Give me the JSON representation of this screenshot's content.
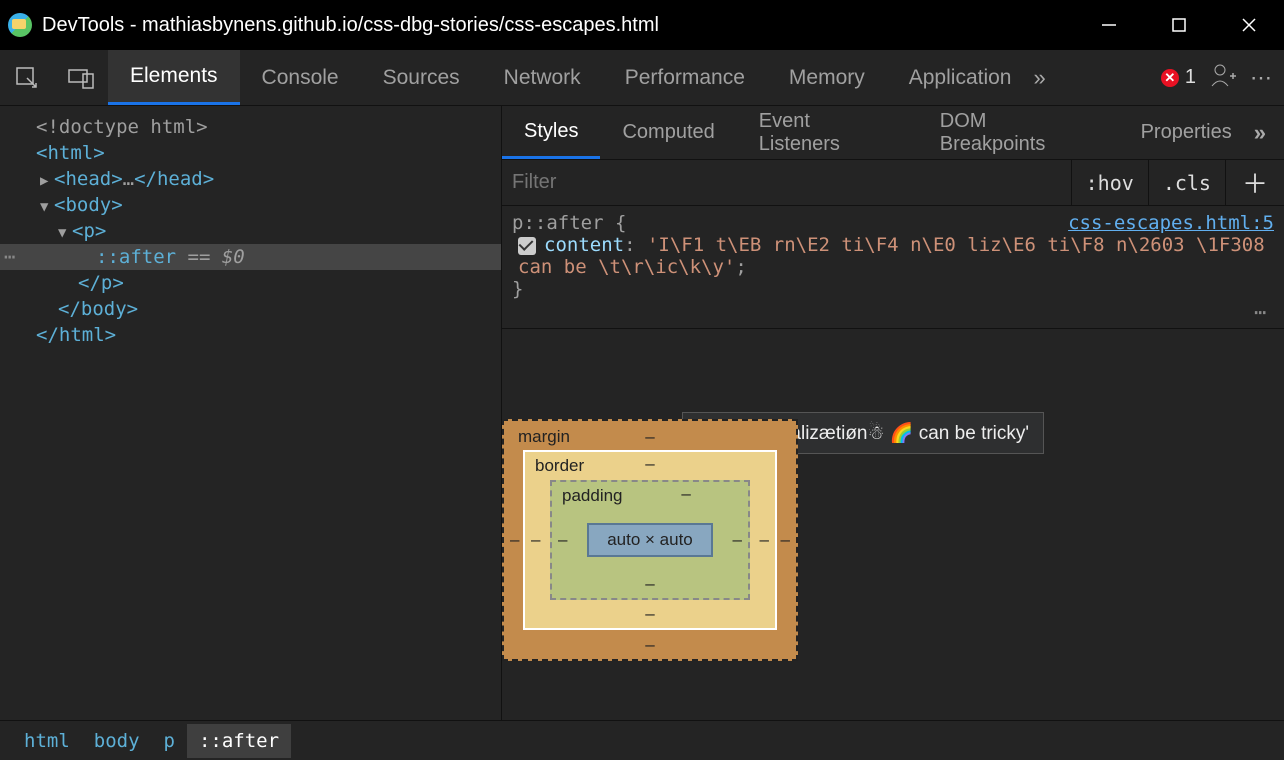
{
  "window": {
    "title": "DevTools - mathiasbynens.github.io/css-dbg-stories/css-escapes.html"
  },
  "toolbar": {
    "error_count": "1",
    "tabs": [
      "Elements",
      "Console",
      "Sources",
      "Network",
      "Performance",
      "Memory",
      "Application"
    ],
    "active_tab": 0
  },
  "dom": {
    "doctype": "<!doctype html>",
    "html_open": "<html>",
    "head": "<head>",
    "head_ellipsis": "…",
    "head_close": "</head>",
    "body_open": "<body>",
    "p_open": "<p>",
    "after": "::after",
    "eq0": "== $0",
    "p_close": "</p>",
    "body_close": "</body>",
    "html_close": "</html>"
  },
  "subTabs": [
    "Styles",
    "Computed",
    "Event Listeners",
    "DOM Breakpoints",
    "Properties"
  ],
  "filter": {
    "placeholder": "Filter",
    "hov": ":hov",
    "cls": ".cls"
  },
  "rule": {
    "selector": "p::after {",
    "source": "css-escapes.html:5",
    "prop": "content",
    "value": "'I\\F1 t\\EB rn\\E2 ti\\F4 n\\E0 liz\\E6 ti\\F8 n\\2603 \\1F308 can be \\t\\r\\ic\\k\\y'",
    "close": "}"
  },
  "tooltip": "'Iñtërnâtiônàlizætiøn☃ 🌈 can be tricky'",
  "boxModel": {
    "margin": "margin",
    "border": "border",
    "padding": "padding",
    "content": "auto × auto",
    "dash": "‒"
  },
  "breadcrumb": [
    "html",
    "body",
    "p",
    "::after"
  ]
}
